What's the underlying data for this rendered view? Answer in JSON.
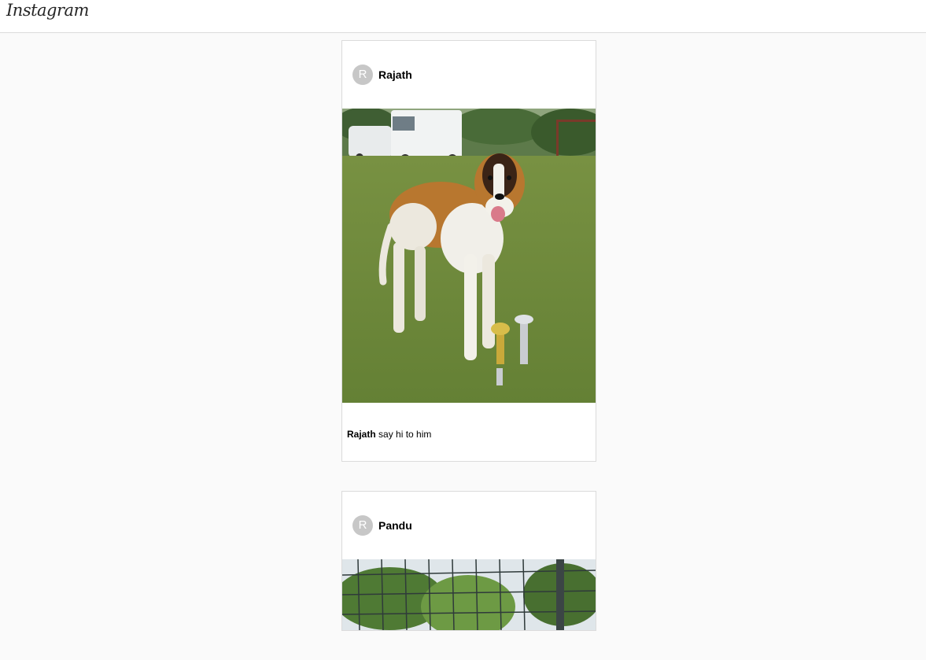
{
  "app": {
    "logo_text": "Instagram"
  },
  "posts": [
    {
      "avatar_initial": "R",
      "username": "Rajath",
      "image_alt": "dog-photo",
      "caption_user": "Rajath",
      "caption_text": "say hi to him"
    },
    {
      "avatar_initial": "R",
      "username": "Pandu",
      "image_alt": "garden-photo"
    }
  ],
  "colors": {
    "border": "#dbdbdb",
    "background": "#fafafa",
    "avatar": "#c7c7c7"
  }
}
